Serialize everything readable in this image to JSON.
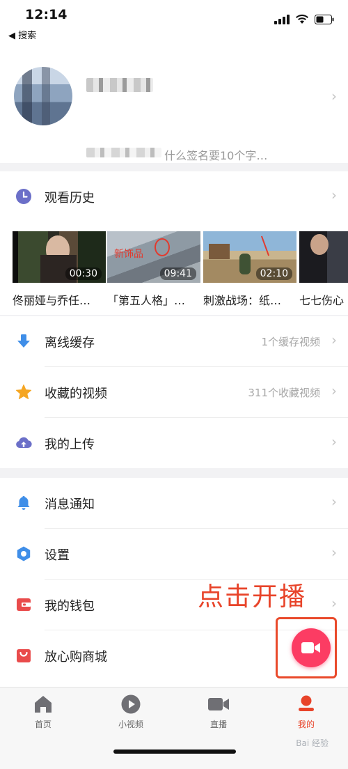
{
  "status_bar": {
    "time": "12:14",
    "back_label": "◀ 搜索"
  },
  "profile": {
    "name": "",
    "signature": "什么签名要10个字…"
  },
  "history": {
    "title": "观看历史",
    "items": [
      {
        "caption": "佟丽娅与乔任…",
        "duration": "00:30"
      },
      {
        "caption": "「第五人格」…",
        "duration": "09:41",
        "overlay_text": "新饰品"
      },
      {
        "caption": "刺激战场：纸…",
        "duration": "02:10"
      },
      {
        "caption": "七七伤心",
        "duration": ""
      }
    ]
  },
  "menu1": [
    {
      "label": "离线缓存",
      "sub": "1个缓存视频",
      "icon": "download-arrow-icon"
    },
    {
      "label": "收藏的视频",
      "sub": "311个收藏视频",
      "icon": "star-icon"
    },
    {
      "label": "我的上传",
      "sub": "",
      "icon": "cloud-upload-icon"
    }
  ],
  "menu2": [
    {
      "label": "消息通知",
      "icon": "bell-icon"
    },
    {
      "label": "设置",
      "icon": "gear-hexagon-icon"
    },
    {
      "label": "我的钱包",
      "icon": "wallet-icon"
    },
    {
      "label": "放心购商城",
      "icon": "shopping-bag-icon"
    }
  ],
  "annotation": "点击开播",
  "tabs": [
    {
      "label": "首页",
      "icon": "house-icon",
      "active": false
    },
    {
      "label": "小视频",
      "icon": "play-circle-icon",
      "active": false
    },
    {
      "label": "直播",
      "icon": "video-camera-icon",
      "active": false
    },
    {
      "label": "我的",
      "icon": "user-icon",
      "active": true
    }
  ],
  "watermark": "Bai 经验",
  "colors": {
    "accent": "#e8442a",
    "live_button": "#fc3c63",
    "icon_purple": "#6b6fc8",
    "icon_blue": "#3f8ee8",
    "icon_orange": "#f5a623",
    "icon_red": "#e94b4b"
  }
}
